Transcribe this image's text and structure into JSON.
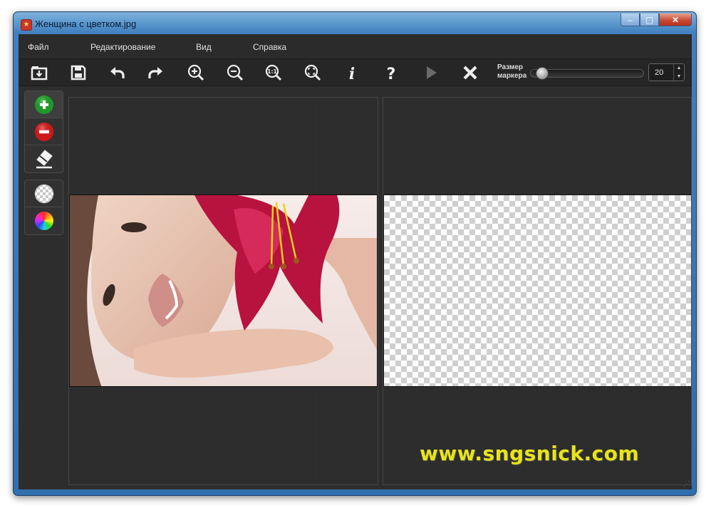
{
  "window": {
    "title": "Женщина с цветком.jpg"
  },
  "menu": {
    "items": [
      "Файл",
      "Редактирование",
      "Вид",
      "Справка"
    ]
  },
  "toolbar": {
    "buttons": [
      "open-icon",
      "save-icon",
      "undo-icon",
      "redo-icon",
      "zoom-in-icon",
      "zoom-out-icon",
      "zoom-actual-icon",
      "zoom-fit-icon",
      "info-icon",
      "help-icon",
      "play-icon",
      "close-x-icon"
    ],
    "marker_label_line1": "Размер",
    "marker_label_line2": "маркера",
    "marker_size": "20",
    "marker_level": 0.05
  },
  "left_tools": {
    "group1": [
      "add-marker-icon",
      "remove-marker-icon",
      "eraser-icon"
    ],
    "group2": [
      "transparency-icon",
      "color-wheel-icon"
    ]
  },
  "watermark": "www.sngsnick.com",
  "colors": {
    "add": "#1e9a2a",
    "remove": "#d01818",
    "watermark": "#e8e41a"
  }
}
